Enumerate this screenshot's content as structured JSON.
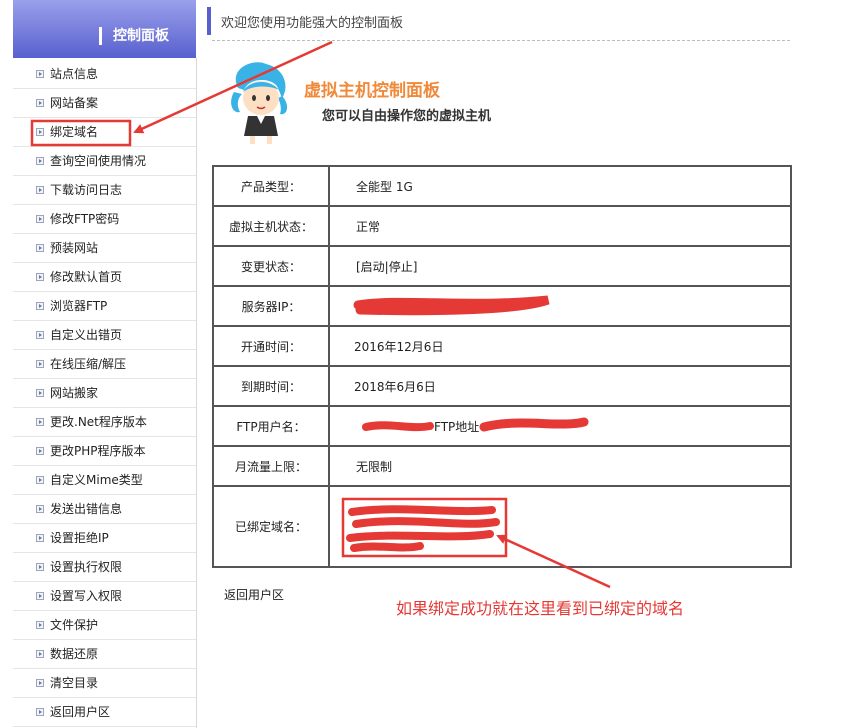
{
  "sidebar": {
    "title": "控制面板",
    "items": [
      {
        "label": "站点信息"
      },
      {
        "label": "网站备案"
      },
      {
        "label": "绑定域名"
      },
      {
        "label": "查询空间使用情况"
      },
      {
        "label": "下载访问日志"
      },
      {
        "label": "修改FTP密码"
      },
      {
        "label": "预装网站"
      },
      {
        "label": "修改默认首页"
      },
      {
        "label": "浏览器FTP"
      },
      {
        "label": "自定义出错页"
      },
      {
        "label": "在线压缩/解压"
      },
      {
        "label": "网站搬家"
      },
      {
        "label": "更改.Net程序版本"
      },
      {
        "label": "更改PHP程序版本"
      },
      {
        "label": "自定义Mime类型"
      },
      {
        "label": "发送出错信息"
      },
      {
        "label": "设置拒绝IP"
      },
      {
        "label": "设置执行权限"
      },
      {
        "label": "设置写入权限"
      },
      {
        "label": "文件保护"
      },
      {
        "label": "数据还原"
      },
      {
        "label": "清空目录"
      },
      {
        "label": "返回用户区"
      }
    ]
  },
  "header": {
    "welcome": "欢迎您使用功能强大的控制面板"
  },
  "panel": {
    "title": "虚拟主机控制面板",
    "subtitle": "您可以自由操作您的虚拟主机"
  },
  "info": {
    "rows": [
      {
        "key": "产品类型：",
        "value": "全能型 1G"
      },
      {
        "key": "虚拟主机状态：",
        "value": "正常"
      },
      {
        "key": "变更状态：",
        "value": "[启动|停止]"
      },
      {
        "key": "服务器IP：",
        "value": ""
      },
      {
        "key": "开通时间：",
        "value": "2016年12月6日"
      },
      {
        "key": "到期时间：",
        "value": "2018年6月6日"
      },
      {
        "key": "FTP用户名：",
        "value": "FTP地址"
      },
      {
        "key": "月流量上限：",
        "value": "无限制"
      },
      {
        "key": "已绑定域名：",
        "value": ""
      }
    ]
  },
  "footer": {
    "back_link": "返回用户区"
  },
  "annotation": {
    "text": "如果绑定成功就在这里看到已绑定的域名"
  },
  "colors": {
    "accent": "#5860cf",
    "highlight": "#e53935",
    "panel_title": "#f08a3a"
  }
}
